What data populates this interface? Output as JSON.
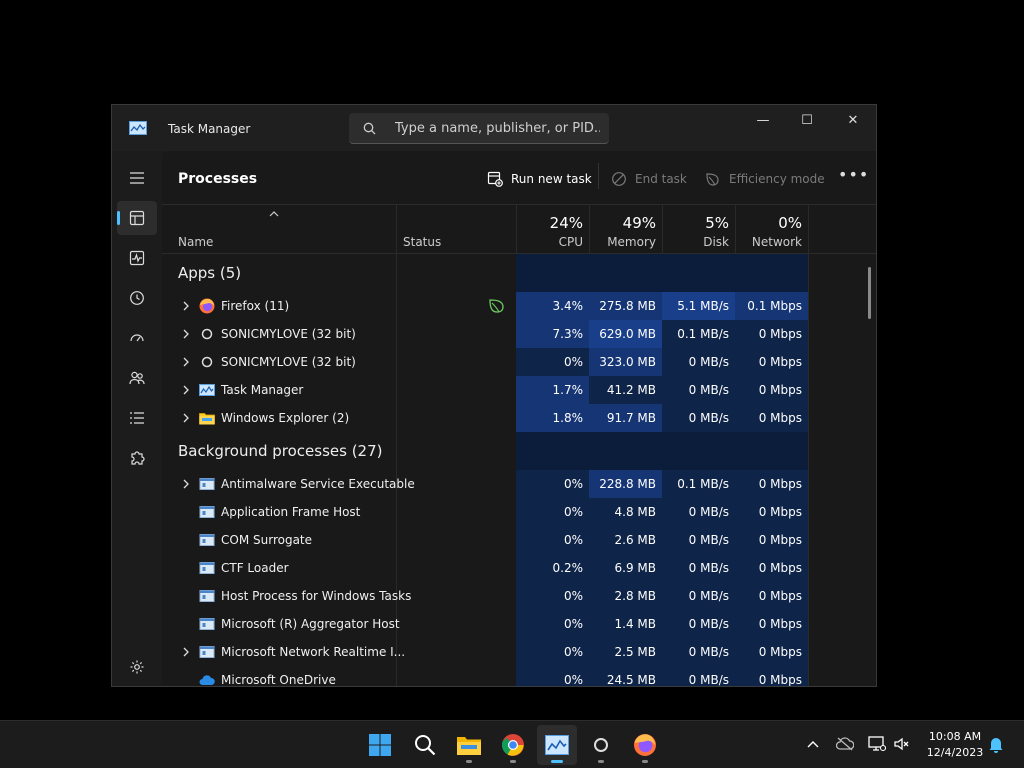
{
  "window": {
    "title": "Task Manager",
    "search_placeholder": "Type a name, publisher, or PID...",
    "controls": {
      "minimize": "—",
      "maximize": "☐",
      "close": "✕"
    }
  },
  "toolbar": {
    "page_title": "Processes",
    "run_new_task": "Run new task",
    "end_task": "End task",
    "efficiency_mode": "Efficiency mode",
    "more": "•••"
  },
  "columns": {
    "name": "Name",
    "status": "Status",
    "cpu": {
      "label": "CPU",
      "pct": "24%"
    },
    "memory": {
      "label": "Memory",
      "pct": "49%"
    },
    "disk": {
      "label": "Disk",
      "pct": "5%"
    },
    "network": {
      "label": "Network",
      "pct": "0%"
    }
  },
  "groups": {
    "apps": "Apps (5)",
    "background": "Background processes (27)"
  },
  "apps": [
    {
      "name": "Firefox (11)",
      "cpu": "3.4%",
      "memory": "275.8 MB",
      "disk": "5.1 MB/s",
      "network": "0.1 Mbps",
      "icon": "firefox-icon"
    },
    {
      "name": "SONICMYLOVE (32 bit)",
      "cpu": "7.3%",
      "memory": "629.0 MB",
      "disk": "0.1 MB/s",
      "network": "0 Mbps",
      "icon": "ring-icon"
    },
    {
      "name": "SONICMYLOVE (32 bit)",
      "cpu": "0%",
      "memory": "323.0 MB",
      "disk": "0 MB/s",
      "network": "0 Mbps",
      "icon": "ring-icon"
    },
    {
      "name": "Task Manager",
      "cpu": "1.7%",
      "memory": "41.2 MB",
      "disk": "0 MB/s",
      "network": "0 Mbps",
      "icon": "task-manager-icon"
    },
    {
      "name": "Windows Explorer (2)",
      "cpu": "1.8%",
      "memory": "91.7 MB",
      "disk": "0 MB/s",
      "network": "0 Mbps",
      "icon": "folder-icon"
    }
  ],
  "background": [
    {
      "name": "Antimalware Service Executable",
      "cpu": "0%",
      "memory": "228.8 MB",
      "disk": "0.1 MB/s",
      "network": "0 Mbps",
      "expand": true
    },
    {
      "name": "Application Frame Host",
      "cpu": "0%",
      "memory": "4.8 MB",
      "disk": "0 MB/s",
      "network": "0 Mbps",
      "expand": false
    },
    {
      "name": "COM Surrogate",
      "cpu": "0%",
      "memory": "2.6 MB",
      "disk": "0 MB/s",
      "network": "0 Mbps",
      "expand": false
    },
    {
      "name": "CTF Loader",
      "cpu": "0.2%",
      "memory": "6.9 MB",
      "disk": "0 MB/s",
      "network": "0 Mbps",
      "expand": false
    },
    {
      "name": "Host Process for Windows Tasks",
      "cpu": "0%",
      "memory": "2.8 MB",
      "disk": "0 MB/s",
      "network": "0 Mbps",
      "expand": false
    },
    {
      "name": "Microsoft (R) Aggregator Host",
      "cpu": "0%",
      "memory": "1.4 MB",
      "disk": "0 MB/s",
      "network": "0 Mbps",
      "expand": false
    },
    {
      "name": "Microsoft Network Realtime I...",
      "cpu": "0%",
      "memory": "2.5 MB",
      "disk": "0 MB/s",
      "network": "0 Mbps",
      "expand": true
    },
    {
      "name": "Microsoft OneDrive",
      "cpu": "0%",
      "memory": "24.5 MB",
      "disk": "0 MB/s",
      "network": "0 Mbps",
      "expand": false
    }
  ],
  "taskbar": {
    "time": "10:08 AM",
    "date": "12/4/2023"
  },
  "colors": {
    "accent": "#4cc2ff",
    "heat_low": "#0f2449",
    "heat_high": "#1a3f8a"
  }
}
